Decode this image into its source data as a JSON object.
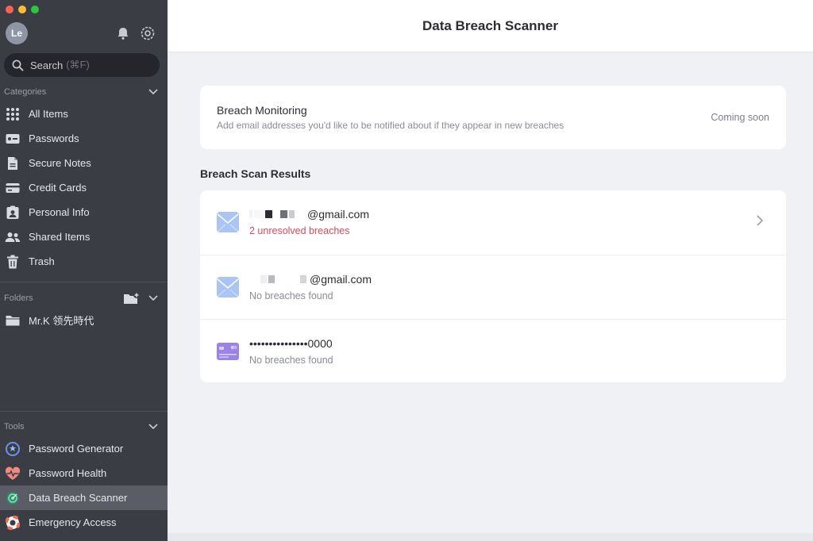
{
  "sidebar": {
    "avatar_initials": "Le",
    "search": {
      "label": "Search",
      "shortcut": "(⌘F)"
    },
    "categories": {
      "heading": "Categories",
      "items": [
        {
          "label": "All Items",
          "icon": "grid-icon"
        },
        {
          "label": "Passwords",
          "icon": "password-icon"
        },
        {
          "label": "Secure Notes",
          "icon": "note-icon"
        },
        {
          "label": "Credit Cards",
          "icon": "credit-card-icon"
        },
        {
          "label": "Personal Info",
          "icon": "id-badge-icon"
        },
        {
          "label": "Shared Items",
          "icon": "users-icon"
        },
        {
          "label": "Trash",
          "icon": "trash-icon"
        }
      ]
    },
    "folders": {
      "heading": "Folders",
      "items": [
        {
          "label": "Mr.K 领先時代",
          "icon": "folder-icon"
        }
      ]
    },
    "tools": {
      "heading": "Tools",
      "items": [
        {
          "label": "Password Generator",
          "icon": "password-generator-icon"
        },
        {
          "label": "Password Health",
          "icon": "heart-pulse-icon"
        },
        {
          "label": "Data Breach Scanner",
          "icon": "radar-icon",
          "active": true
        },
        {
          "label": "Emergency Access",
          "icon": "lifebuoy-icon"
        }
      ]
    }
  },
  "main": {
    "title": "Data Breach Scanner",
    "monitoring": {
      "title": "Breach Monitoring",
      "subtitle": "Add email addresses you'd like to be notified about if they appear in new breaches",
      "status": "Coming soon"
    },
    "results_title": "Breach Scan Results",
    "results": [
      {
        "value": "@gmail.com",
        "status": "2 unresolved breaches",
        "icon": "envelope-icon"
      },
      {
        "value": "@gmail.com",
        "status": "No breaches found",
        "icon": "envelope-icon"
      },
      {
        "value": "•••••••••••••••0000",
        "status": "No breaches found",
        "icon": "credit-card-icon"
      }
    ]
  },
  "colors": {
    "sidebar_bg": "#3b3d45",
    "active_item_bg": "#5b5d66",
    "alert_red": "#e0475a",
    "envelope_blue": "#a9c4f5",
    "card_purple": "#9b83e6"
  }
}
